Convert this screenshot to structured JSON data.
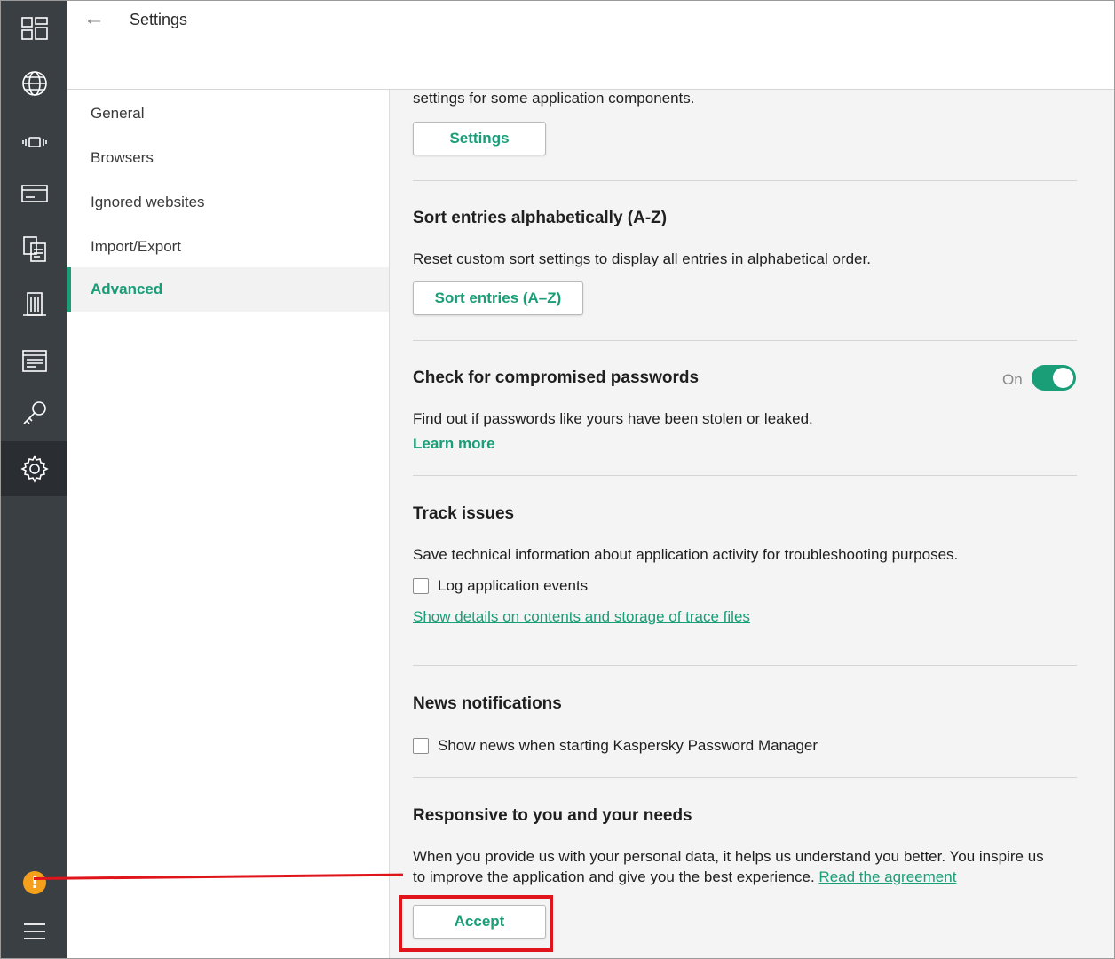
{
  "header": {
    "title": "Settings",
    "back_glyph": "←"
  },
  "rail": {
    "icons": [
      "dashboard-icon",
      "globe-icon",
      "vibration-icon",
      "credit-card-icon",
      "documents-icon",
      "building-icon",
      "notes-icon",
      "key-icon",
      "gear-icon"
    ],
    "active": "gear-icon",
    "alert_glyph": "!",
    "alert_color": "#f5a01a"
  },
  "nav": {
    "items": [
      {
        "label": "General"
      },
      {
        "label": "Browsers"
      },
      {
        "label": "Ignored websites"
      },
      {
        "label": "Import/Export"
      },
      {
        "label": "Advanced"
      }
    ],
    "active_index": 4
  },
  "content": {
    "top_text": "settings for some application components.",
    "settings_button": "Settings",
    "sort": {
      "title": "Sort entries alphabetically (A-Z)",
      "desc": "Reset custom sort settings to display all entries in alphabetical order.",
      "button": "Sort entries (A–Z)"
    },
    "compromised": {
      "title": "Check for compromised passwords",
      "toggle_label": "On",
      "toggle_on": true,
      "desc": "Find out if passwords like yours have been stolen or leaked.",
      "link": "Learn more"
    },
    "track": {
      "title": "Track issues",
      "desc": "Save technical information about application activity for troubleshooting purposes.",
      "checkbox_label": "Log application events",
      "checkbox_checked": false,
      "link": "Show details on contents and storage of trace files"
    },
    "news": {
      "title": "News notifications",
      "checkbox_label": "Show news when starting Kaspersky Password Manager",
      "checkbox_checked": false
    },
    "responsive": {
      "title": "Responsive to you and your needs",
      "desc_line1": "When you provide us with your personal data, it helps us understand you better. You inspire us",
      "desc_line2": "to improve the application and give you the best experience.",
      "link": "Read the agreement",
      "button": "Accept"
    }
  },
  "colors": {
    "accent": "#1a9e78",
    "rail": "#3a3f44",
    "highlight": "#e0151c"
  }
}
